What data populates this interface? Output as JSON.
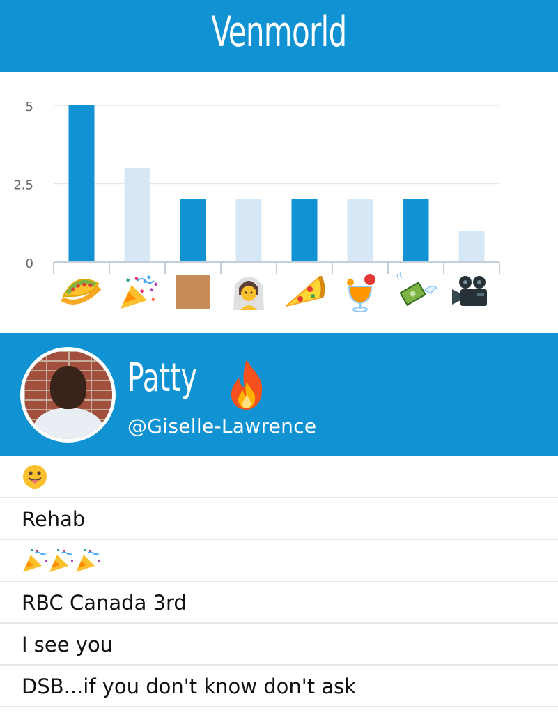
{
  "header": {
    "title": "Venmorld"
  },
  "chart_data": {
    "type": "bar",
    "categories": [
      "taco",
      "party-popper",
      "brown-square",
      "bride-with-veil",
      "pizza",
      "tropical-drink",
      "money-with-wings",
      "movie-camera"
    ],
    "values": [
      5,
      3,
      2,
      2,
      2,
      2,
      2,
      1
    ],
    "ylim": [
      0,
      5
    ],
    "yticks": [
      "0",
      "2.5",
      "5"
    ],
    "grid": true,
    "colors": [
      "#1193d3",
      "#d6e8f6",
      "#1193d3",
      "#d6e8f6",
      "#1193d3",
      "#d6e8f6",
      "#1193d3",
      "#d6e8f6"
    ]
  },
  "profile": {
    "name": "Patty",
    "handle": "@Giselle-Lawrence",
    "status_icon": "fire-icon",
    "avatar": "avatar-photo"
  },
  "messages": [
    {
      "kind": "emoji",
      "icon": "face-with-tongue-icon"
    },
    {
      "kind": "text",
      "text": "Rehab"
    },
    {
      "kind": "emoji",
      "icon": "party-popper-icon",
      "count": 3
    },
    {
      "kind": "text",
      "text": "RBC Canada 3rd"
    },
    {
      "kind": "text",
      "text": "I see you"
    },
    {
      "kind": "text",
      "text": "DSB...if you don't know don't ask"
    }
  ]
}
